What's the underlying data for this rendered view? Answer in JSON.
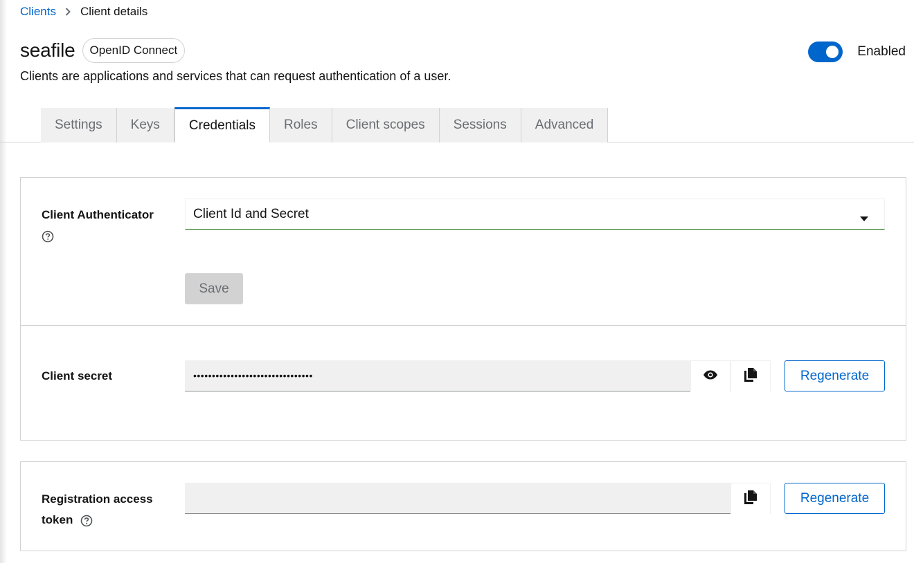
{
  "breadcrumb": {
    "parent": "Clients",
    "current": "Client details"
  },
  "header": {
    "title": "seafile",
    "protocol_badge": "OpenID Connect",
    "description": "Clients are applications and services that can request authentication of a user.",
    "enabled_label": "Enabled",
    "enabled": true
  },
  "tabs": [
    {
      "label": "Settings"
    },
    {
      "label": "Keys"
    },
    {
      "label": "Credentials",
      "active": true
    },
    {
      "label": "Roles"
    },
    {
      "label": "Client scopes"
    },
    {
      "label": "Sessions"
    },
    {
      "label": "Advanced"
    }
  ],
  "credentials": {
    "authenticator_label": "Client Authenticator",
    "authenticator_value": "Client Id and Secret",
    "save_label": "Save",
    "secret_label": "Client secret",
    "secret_value": "••••••••••••••••••••••••••••••••",
    "regenerate_label": "Regenerate",
    "registration_label_line1": "Registration access",
    "registration_label_line2": "token",
    "registration_value": ""
  },
  "colors": {
    "primary": "#0066cc",
    "select_underline": "#3e8635",
    "disabled_bg": "#d2d2d2",
    "tab_bg": "#f0f0f0"
  }
}
